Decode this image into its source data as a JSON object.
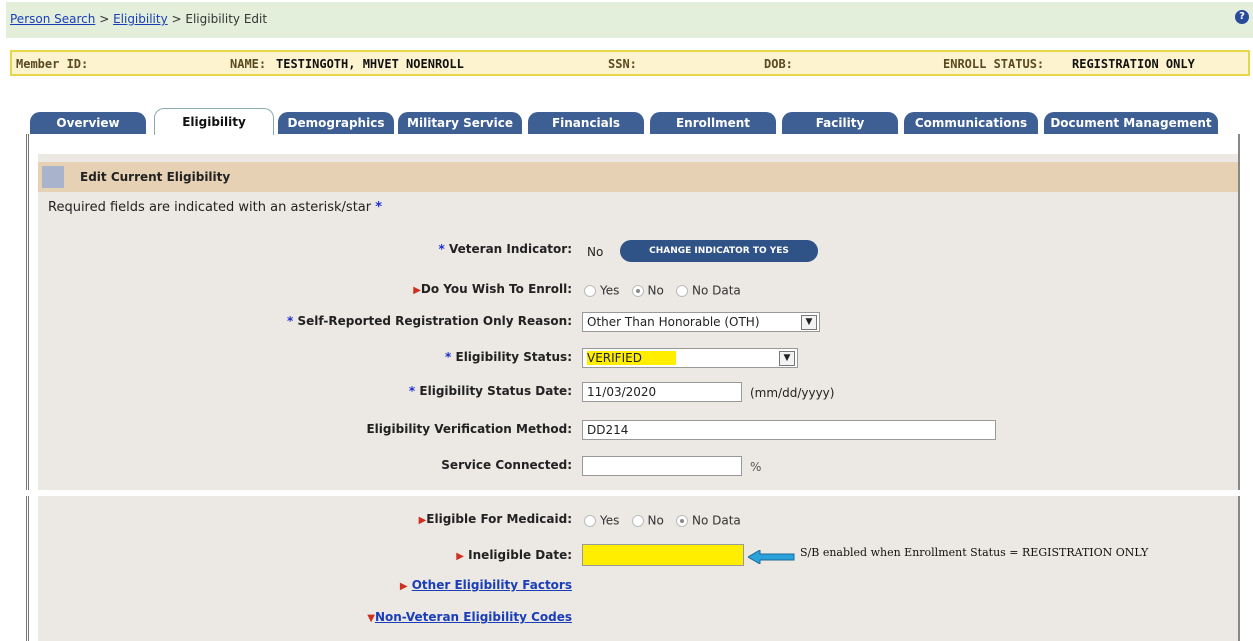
{
  "breadcrumb": {
    "person_search": "Person Search",
    "sep1": " > ",
    "eligibility": "Eligibility",
    "sep2": " > ",
    "current": "Eligibility Edit"
  },
  "help_icon": "?",
  "member_bar": {
    "member_id_label": "Member ID:",
    "name_label": "NAME:",
    "name_value": "TESTINGOTH, MHVET NOENROLL",
    "ssn_label": "SSN:",
    "dob_label": "DOB:",
    "enroll_status_label": "ENROLL STATUS:",
    "enroll_status_value": "REGISTRATION ONLY"
  },
  "tabs": [
    "Overview",
    "Eligibility",
    "Demographics",
    "Military Service",
    "Financials",
    "Enrollment",
    "Facility",
    "Communications",
    "Document Management"
  ],
  "active_tab": "Eligibility",
  "panel": {
    "title": "Edit Current Eligibility",
    "required_note": "Required fields are indicated with an asterisk/star",
    "star": "*"
  },
  "form": {
    "veteran_indicator": {
      "label": "Veteran Indicator:",
      "value": "No",
      "button": "CHANGE INDICATOR TO YES"
    },
    "do_you_wish_to_enroll": {
      "label": "Do You Wish To Enroll:",
      "options": [
        "Yes",
        "No",
        "No Data"
      ],
      "selected": "No"
    },
    "registration_only_reason": {
      "label": "Self-Reported Registration Only Reason:",
      "value": "Other Than Honorable (OTH)"
    },
    "eligibility_status": {
      "label": "Eligibility Status:",
      "value": "VERIFIED"
    },
    "eligibility_status_date": {
      "label": "Eligibility Status Date:",
      "value": "11/03/2020",
      "hint": "(mm/dd/yyyy)"
    },
    "verification_method": {
      "label": "Eligibility Verification Method:",
      "value": "DD214"
    },
    "service_connected": {
      "label": "Service Connected:",
      "value": "",
      "unit": "%"
    },
    "eligible_for_medicaid": {
      "label": "Eligible For Medicaid:",
      "options": [
        "Yes",
        "No",
        "No Data"
      ],
      "selected": "No Data"
    },
    "ineligible_date": {
      "label": "Ineligible Date:",
      "value": ""
    },
    "other_factors_link": "Other Eligibility Factors",
    "non_veteran_codes_link": "Non-Veteran Eligibility Codes"
  },
  "annotation": "S/B enabled when Enrollment Status = REGISTRATION ONLY",
  "colors": {
    "tab_bg": "#3d5f94",
    "highlight": "#ffee00",
    "header_bg": "#e6d1b5",
    "annotation_arrow": "#29a3d9"
  }
}
